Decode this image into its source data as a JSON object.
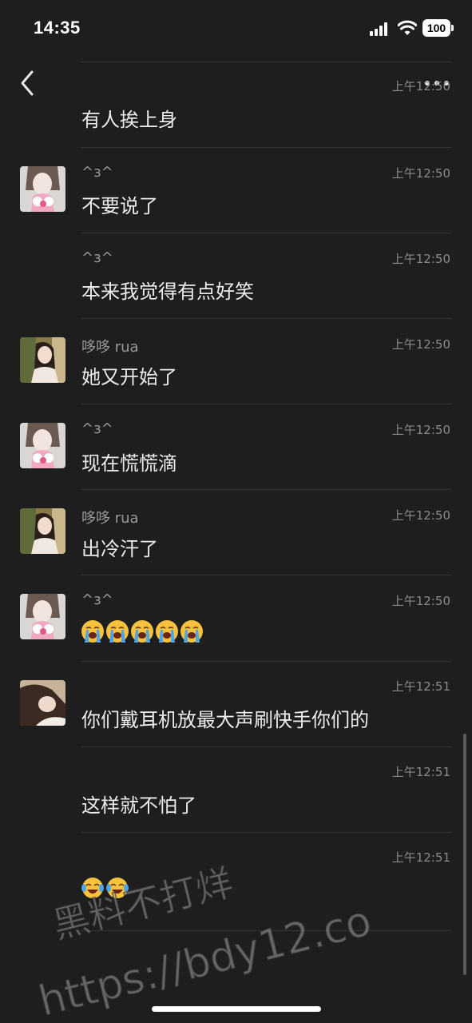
{
  "status_bar": {
    "time": "14:35",
    "battery": "100"
  },
  "messages": [
    {
      "sender": "",
      "time": "上午12:50",
      "text": "有人挨上身"
    },
    {
      "sender": "^з^",
      "time": "上午12:50",
      "text": "不要说了",
      "avatar": "avatar-girl-pink"
    },
    {
      "sender": "^з^",
      "time": "上午12:50",
      "text": "本来我觉得有点好笑"
    },
    {
      "sender": "哆哆 rua",
      "time": "上午12:50",
      "text": "她又开始了",
      "avatar": "avatar-girl-cafe"
    },
    {
      "sender": "^з^",
      "time": "上午12:50",
      "text": "现在慌慌滴",
      "avatar": "avatar-girl-pink"
    },
    {
      "sender": "哆哆 rua",
      "time": "上午12:50",
      "text": "出冷汗了",
      "avatar": "avatar-girl-cafe"
    },
    {
      "sender": "^з^",
      "time": "上午12:50",
      "emoji": [
        "loudly-crying-face",
        "loudly-crying-face",
        "loudly-crying-face",
        "loudly-crying-face",
        "loudly-crying-face"
      ],
      "avatar": "avatar-girl-pink"
    },
    {
      "sender": "",
      "time": "上午12:51",
      "text": "你们戴耳机放最大声刷快手你们的",
      "avatar": "avatar-girl-lying"
    },
    {
      "sender": "",
      "time": "上午12:51",
      "text": "这样就不怕了"
    },
    {
      "sender": "",
      "time": "上午12:51",
      "emoji": [
        "face-with-tears-of-joy",
        "face-with-tears-of-joy"
      ]
    }
  ],
  "watermark": {
    "line1": "黑料不打烊",
    "line2": "https://bdy12.co"
  },
  "colors": {
    "background": "#1e1e1e",
    "text": "#ececec",
    "muted": "#9a9a9a",
    "divider": "#333333"
  }
}
